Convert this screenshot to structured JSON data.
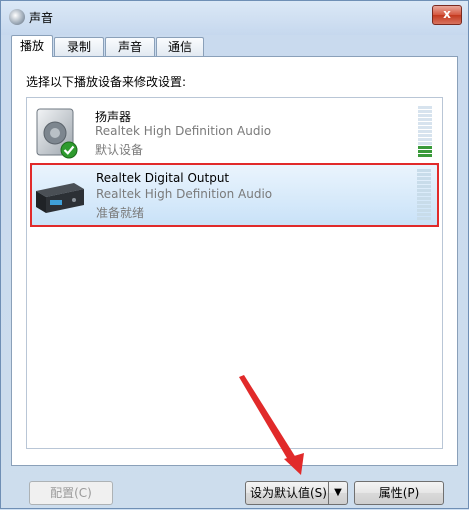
{
  "window": {
    "title": "声音",
    "close_label": "x"
  },
  "tabs": [
    {
      "label": "播放",
      "active": true
    },
    {
      "label": "录制",
      "active": false
    },
    {
      "label": "声音",
      "active": false
    },
    {
      "label": "通信",
      "active": false
    }
  ],
  "instruction": "选择以下播放设备来修改设置:",
  "devices": [
    {
      "name": "扬声器",
      "description": "Realtek High Definition Audio",
      "status": "默认设备",
      "icon": "speaker-icon",
      "level_bars_lit": 3,
      "selected": false
    },
    {
      "name": "Realtek Digital Output",
      "description": "Realtek High Definition Audio",
      "status": "准备就绪",
      "icon": "digital-output-icon",
      "level_bars_lit": 0,
      "selected": true
    }
  ],
  "buttons": {
    "configure": "配置(C)",
    "set_default": "设为默认值(S)",
    "set_default_dropdown": "▼",
    "properties": "属性(P)"
  },
  "colors": {
    "highlight": "#e12a2a",
    "annotation_arrow": "#e12a2a",
    "selection": "#c9e2f8",
    "level_on": "#3a9a3a"
  }
}
